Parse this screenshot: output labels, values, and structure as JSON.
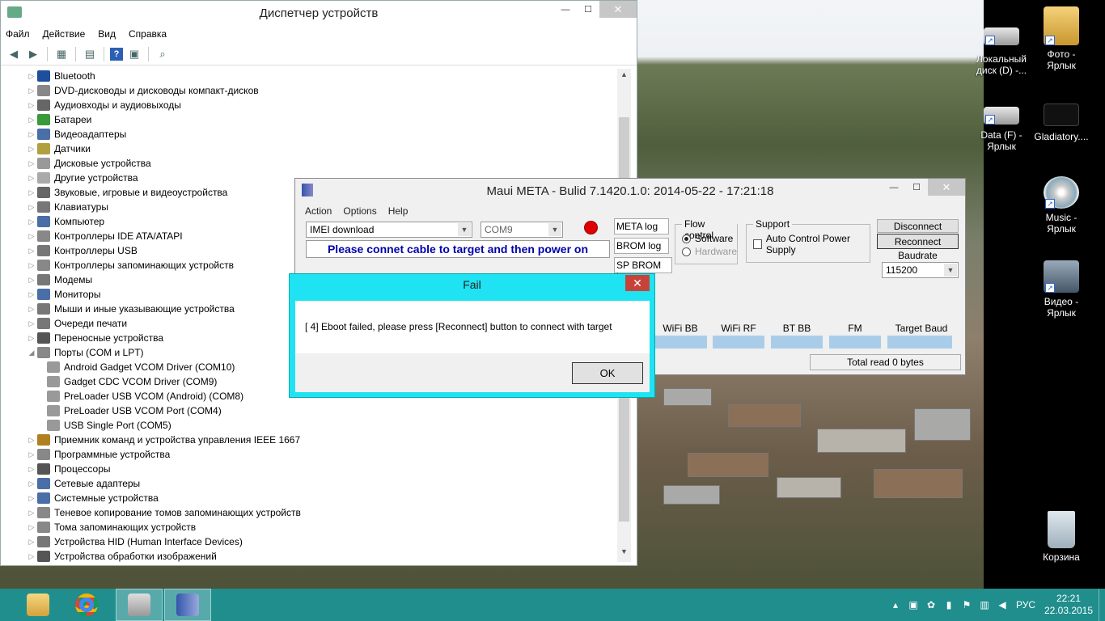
{
  "colors": {
    "accent": "#1fe3f2",
    "taskbar": "#1f8e8c",
    "message_text": "#0000aa",
    "status_red": "#e00000"
  },
  "device_manager": {
    "title": "Диспетчер устройств",
    "menu": [
      "Файл",
      "Действие",
      "Вид",
      "Справка"
    ],
    "tree": [
      {
        "label": "Bluetooth",
        "icon": "bluetooth-icon",
        "color": "#1d4f9c",
        "expanded": false,
        "level": 0
      },
      {
        "label": "DVD-дисководы и дисководы компакт-дисков",
        "icon": "dvd-drive-icon",
        "color": "#888888",
        "expanded": false,
        "level": 0
      },
      {
        "label": "Аудиовходы и аудиовыходы",
        "icon": "speaker-icon",
        "color": "#666666",
        "expanded": false,
        "level": 0
      },
      {
        "label": "Батареи",
        "icon": "battery-icon",
        "color": "#3a9a3a",
        "expanded": false,
        "level": 0
      },
      {
        "label": "Видеоадаптеры",
        "icon": "display-adapter-icon",
        "color": "#4a6ea8",
        "expanded": false,
        "level": 0
      },
      {
        "label": "Датчики",
        "icon": "sensor-icon",
        "color": "#b0a040",
        "expanded": false,
        "level": 0
      },
      {
        "label": "Дисковые устройства",
        "icon": "disk-drive-icon",
        "color": "#999999",
        "expanded": false,
        "level": 0
      },
      {
        "label": "Другие устройства",
        "icon": "other-devices-icon",
        "color": "#aaaaaa",
        "expanded": false,
        "level": 0
      },
      {
        "label": "Звуковые, игровые и видеоустройства",
        "icon": "sound-icon",
        "color": "#666666",
        "expanded": false,
        "level": 0
      },
      {
        "label": "Клавиатуры",
        "icon": "keyboard-icon",
        "color": "#777777",
        "expanded": false,
        "level": 0
      },
      {
        "label": "Компьютер",
        "icon": "computer-icon",
        "color": "#4a6ea8",
        "expanded": false,
        "level": 0
      },
      {
        "label": "Контроллеры IDE ATA/ATAPI",
        "icon": "ide-controller-icon",
        "color": "#888888",
        "expanded": false,
        "level": 0
      },
      {
        "label": "Контроллеры USB",
        "icon": "usb-icon",
        "color": "#777777",
        "expanded": false,
        "level": 0
      },
      {
        "label": "Контроллеры запоминающих устройств",
        "icon": "storage-controller-icon",
        "color": "#888888",
        "expanded": false,
        "level": 0
      },
      {
        "label": "Модемы",
        "icon": "modem-icon",
        "color": "#777777",
        "expanded": false,
        "level": 0
      },
      {
        "label": "Мониторы",
        "icon": "monitor-icon",
        "color": "#4a6ea8",
        "expanded": false,
        "level": 0
      },
      {
        "label": "Мыши и иные указывающие устройства",
        "icon": "mouse-icon",
        "color": "#777777",
        "expanded": false,
        "level": 0
      },
      {
        "label": "Очереди печати",
        "icon": "printer-icon",
        "color": "#777777",
        "expanded": false,
        "level": 0
      },
      {
        "label": "Переносные устройства",
        "icon": "portable-device-icon",
        "color": "#555555",
        "expanded": false,
        "level": 0
      },
      {
        "label": "Порты (COM и LPT)",
        "icon": "port-icon",
        "color": "#888888",
        "expanded": true,
        "level": 0
      },
      {
        "label": "Android Gadget VCOM Driver (COM10)",
        "icon": "port-icon",
        "color": "#999999",
        "expanded": null,
        "level": 1
      },
      {
        "label": "Gadget CDC VCOM Driver (COM9)",
        "icon": "port-icon",
        "color": "#999999",
        "expanded": null,
        "level": 1
      },
      {
        "label": "PreLoader USB VCOM (Android) (COM8)",
        "icon": "port-icon",
        "color": "#999999",
        "expanded": null,
        "level": 1
      },
      {
        "label": "PreLoader USB VCOM Port (COM4)",
        "icon": "port-icon",
        "color": "#999999",
        "expanded": null,
        "level": 1
      },
      {
        "label": "USB Single Port (COM5)",
        "icon": "port-icon",
        "color": "#999999",
        "expanded": null,
        "level": 1
      },
      {
        "label": "Приемник команд и устройства управления IEEE 1667",
        "icon": "ieee-device-icon",
        "color": "#b08020",
        "expanded": false,
        "level": 0
      },
      {
        "label": "Программные устройства",
        "icon": "software-device-icon",
        "color": "#888888",
        "expanded": false,
        "level": 0
      },
      {
        "label": "Процессоры",
        "icon": "processor-icon",
        "color": "#555555",
        "expanded": false,
        "level": 0
      },
      {
        "label": "Сетевые адаптеры",
        "icon": "network-adapter-icon",
        "color": "#4a6ea8",
        "expanded": false,
        "level": 0
      },
      {
        "label": "Системные устройства",
        "icon": "system-device-icon",
        "color": "#4a6ea8",
        "expanded": false,
        "level": 0
      },
      {
        "label": "Теневое копирование томов запоминающих устройств",
        "icon": "volume-shadow-icon",
        "color": "#888888",
        "expanded": false,
        "level": 0
      },
      {
        "label": "Тома запоминающих устройств",
        "icon": "storage-volume-icon",
        "color": "#888888",
        "expanded": false,
        "level": 0
      },
      {
        "label": "Устройства HID (Human Interface Devices)",
        "icon": "hid-icon",
        "color": "#777777",
        "expanded": false,
        "level": 0
      },
      {
        "label": "Устройства обработки изображений",
        "icon": "imaging-device-icon",
        "color": "#555555",
        "expanded": false,
        "level": 0
      }
    ]
  },
  "maui": {
    "title": "Maui META - Bulid 7.1420.1.0: 2014-05-22 - 17:21:18",
    "menu": [
      "Action",
      "Options",
      "Help"
    ],
    "mode_select": "IMEI download",
    "port_select": "COM9",
    "message": "Please connet cable to target and then power on",
    "meta_log": "META log",
    "brom_log": "BROM log",
    "sp_brom_log": "SP BROM log",
    "flow_control": {
      "label": "Flow control",
      "software": "Software",
      "hardware": "Hardware"
    },
    "support": {
      "label": "Support",
      "auto_power": "Auto Control Power Supply"
    },
    "disconnect": "Disconnect",
    "reconnect": "Reconnect",
    "baudrate_label": "Baudrate",
    "baudrate": "115200",
    "stats": [
      "WiFi BB",
      "WiFi RF",
      "BT BB",
      "FM",
      "Target Baud Rate"
    ],
    "total_read": "Total read 0 bytes"
  },
  "fail_dialog": {
    "title": "Fail",
    "message": "[    4] Eboot failed, please press [Reconnect] button to connect with target",
    "ok": "OK"
  },
  "desktop_icons": [
    {
      "label": "Локальный диск (D) -...",
      "icon": "drive-icon"
    },
    {
      "label": "Фото - Ярлык",
      "icon": "folder-icon"
    },
    {
      "label": "Data (F) - Ярлык",
      "icon": "drive-icon"
    },
    {
      "label": "Gladiatory....",
      "icon": "video-file-icon"
    },
    {
      "label": "Music - Ярлык",
      "icon": "music-cd-icon"
    },
    {
      "label": "Видео - Ярлык",
      "icon": "camera-icon"
    },
    {
      "label": "Корзина",
      "icon": "recycle-bin-icon"
    }
  ],
  "taskbar": {
    "language": "РУС",
    "time": "22:21",
    "date": "22.03.2015"
  }
}
